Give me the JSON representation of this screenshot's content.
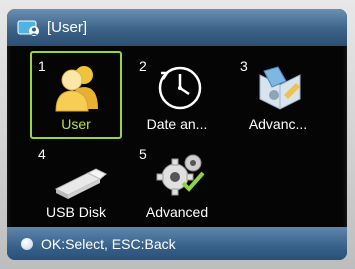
{
  "window": {
    "title": "[User]"
  },
  "tiles": [
    {
      "number": "1",
      "label": "User",
      "icon": "user-icon",
      "selected": true
    },
    {
      "number": "2",
      "label": "Date an...",
      "icon": "clock-icon",
      "selected": false
    },
    {
      "number": "3",
      "label": "Advanc...",
      "icon": "settings-book-icon",
      "selected": false
    },
    {
      "number": "4",
      "label": "USB Disk",
      "icon": "usb-drive-icon",
      "selected": false
    },
    {
      "number": "5",
      "label": "Advanced",
      "icon": "gear-icon",
      "selected": false
    }
  ],
  "status": {
    "text": "OK:Select, ESC:Back"
  },
  "colors": {
    "selection": "#9fd33a",
    "titlebar": "#3d6388",
    "background": "#050505"
  }
}
